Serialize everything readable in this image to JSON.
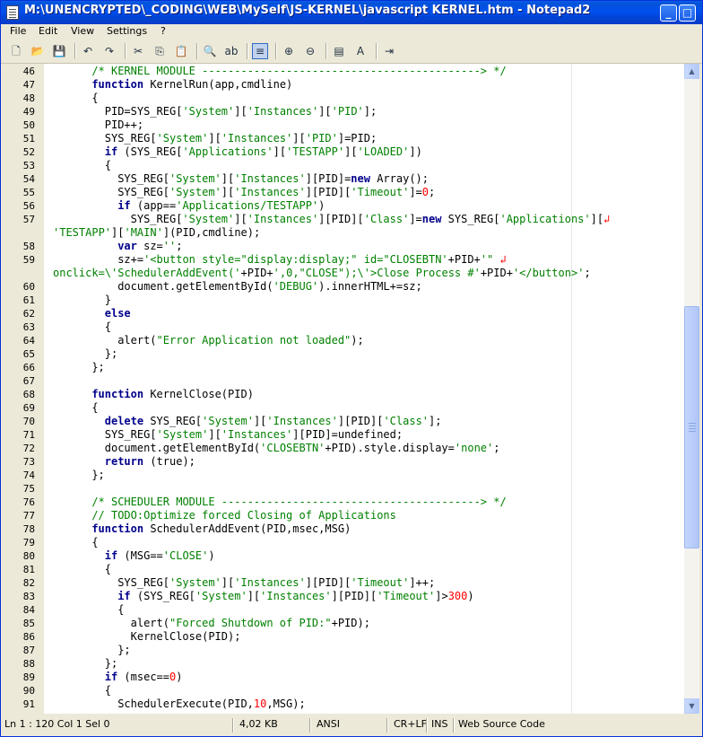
{
  "window": {
    "title": "M:\\UNENCRYPTED\\_CODING\\WEB\\MySelf\\JS-KERNEL\\javascript KERNEL.htm - Notepad2",
    "minimize_glyph": "_",
    "maximize_glyph": "□",
    "close_glyph": "✕"
  },
  "menu": [
    "File",
    "Edit",
    "View",
    "Settings",
    "?"
  ],
  "toolbar_icons": [
    "new-icon",
    "open-icon",
    "save-icon",
    "undo-icon",
    "redo-icon",
    "cut-icon",
    "copy-icon",
    "paste-icon",
    "find-icon",
    "replace-icon",
    "word-wrap-icon",
    "zoom-in-icon",
    "zoom-out-icon",
    "scheme-icon",
    "font-icon",
    "exit-icon"
  ],
  "colors": {
    "keyword": "#00008b",
    "string": "#008000",
    "number": "#ff0000",
    "comment": "#008000",
    "text": "#000000",
    "wrap_marker": "#ff0000"
  },
  "editor": {
    "lines": [
      {
        "n": "46",
        "t": [
          [
            "c",
            "/* KERNEL MODULE -------------------------------------------> */"
          ]
        ]
      },
      {
        "n": "47",
        "t": [
          [
            "k",
            "function"
          ],
          [
            "p",
            " KernelRun(app,cmdline)"
          ]
        ]
      },
      {
        "n": "48",
        "t": [
          [
            "p",
            "{"
          ]
        ]
      },
      {
        "n": "49",
        "t": [
          [
            "p",
            "PID=SYS_REG["
          ],
          [
            "s",
            "'System'"
          ],
          [
            "p",
            "]["
          ],
          [
            "s",
            "'Instances'"
          ],
          [
            "p",
            "]["
          ],
          [
            "s",
            "'PID'"
          ],
          [
            "p",
            "];"
          ]
        ]
      },
      {
        "n": "50",
        "t": [
          [
            "p",
            "PID++;"
          ]
        ]
      },
      {
        "n": "51",
        "t": [
          [
            "p",
            "SYS_REG["
          ],
          [
            "s",
            "'System'"
          ],
          [
            "p",
            "]["
          ],
          [
            "s",
            "'Instances'"
          ],
          [
            "p",
            "]["
          ],
          [
            "s",
            "'PID'"
          ],
          [
            "p",
            "]=PID;"
          ]
        ]
      },
      {
        "n": "52",
        "t": [
          [
            "k",
            "if"
          ],
          [
            "p",
            " (SYS_REG["
          ],
          [
            "s",
            "'Applications'"
          ],
          [
            "p",
            "]["
          ],
          [
            "s",
            "'TESTAPP'"
          ],
          [
            "p",
            "]["
          ],
          [
            "s",
            "'LOADED'"
          ],
          [
            "p",
            "])"
          ]
        ]
      },
      {
        "n": "53",
        "t": [
          [
            "p",
            "{"
          ]
        ]
      },
      {
        "n": "54",
        "t": [
          [
            "p",
            "SYS_REG["
          ],
          [
            "s",
            "'System'"
          ],
          [
            "p",
            "]["
          ],
          [
            "s",
            "'Instances'"
          ],
          [
            "p",
            "][PID]="
          ],
          [
            "k",
            "new"
          ],
          [
            "p",
            " Array();"
          ]
        ]
      },
      {
        "n": "55",
        "t": [
          [
            "p",
            "SYS_REG["
          ],
          [
            "s",
            "'System'"
          ],
          [
            "p",
            "]["
          ],
          [
            "s",
            "'Instances'"
          ],
          [
            "p",
            "][PID]["
          ],
          [
            "s",
            "'Timeout'"
          ],
          [
            "p",
            "]="
          ],
          [
            "n",
            "0"
          ],
          [
            "p",
            ";"
          ]
        ]
      },
      {
        "n": "56",
        "t": [
          [
            "k",
            "if"
          ],
          [
            "p",
            " (app=="
          ],
          [
            "s",
            "'Applications/TESTAPP'"
          ],
          [
            "p",
            ")"
          ]
        ]
      },
      {
        "n": "57",
        "t": [
          [
            "p",
            "SYS_REG["
          ],
          [
            "s",
            "'System'"
          ],
          [
            "p",
            "]["
          ],
          [
            "s",
            "'Instances'"
          ],
          [
            "p",
            "][PID]["
          ],
          [
            "s",
            "'Class'"
          ],
          [
            "p",
            "]="
          ],
          [
            "k",
            "new"
          ],
          [
            "p",
            " SYS_REG["
          ],
          [
            "s",
            "'Applications'"
          ],
          [
            "p",
            "]["
          ],
          [
            "w",
            "↲"
          ]
        ]
      },
      {
        "n": "",
        "t": [
          [
            "s",
            "'TESTAPP'"
          ],
          [
            "p",
            "]["
          ],
          [
            "s",
            "'MAIN'"
          ],
          [
            "p",
            "](PID,cmdline);"
          ]
        ]
      },
      {
        "n": "58",
        "t": [
          [
            "k",
            "var"
          ],
          [
            "p",
            " sz="
          ],
          [
            "s",
            "''"
          ],
          [
            "p",
            ";"
          ]
        ]
      },
      {
        "n": "59",
        "t": [
          [
            "p",
            "sz+="
          ],
          [
            "s",
            "'<button style=\"display:display;\" id=\"CLOSEBTN'"
          ],
          [
            "p",
            "+PID+"
          ],
          [
            "s",
            "'\" "
          ],
          [
            "w",
            "↲"
          ]
        ]
      },
      {
        "n": "",
        "t": [
          [
            "s",
            "onclick=\\'SchedulerAddEvent('"
          ],
          [
            "p",
            "+PID+"
          ],
          [
            "s",
            "',0,\"CLOSE\");\\'>Close Process #'"
          ],
          [
            "p",
            "+PID+"
          ],
          [
            "s",
            "'</button>'"
          ],
          [
            "p",
            ";"
          ]
        ]
      },
      {
        "n": "60",
        "t": [
          [
            "p",
            "document.getElementById("
          ],
          [
            "s",
            "'DEBUG'"
          ],
          [
            "p",
            ").innerHTML+=sz;"
          ]
        ]
      },
      {
        "n": "61",
        "t": [
          [
            "p",
            "}"
          ]
        ]
      },
      {
        "n": "62",
        "t": [
          [
            "k",
            "else"
          ]
        ]
      },
      {
        "n": "63",
        "t": [
          [
            "p",
            "{"
          ]
        ]
      },
      {
        "n": "64",
        "t": [
          [
            "p",
            "alert("
          ],
          [
            "s",
            "\"Error Application not loaded\""
          ],
          [
            "p",
            ");"
          ]
        ]
      },
      {
        "n": "65",
        "t": [
          [
            "p",
            "};"
          ]
        ]
      },
      {
        "n": "66",
        "t": [
          [
            "p",
            "};"
          ]
        ]
      },
      {
        "n": "67",
        "t": []
      },
      {
        "n": "68",
        "t": [
          [
            "k",
            "function"
          ],
          [
            "p",
            " KernelClose(PID)"
          ]
        ]
      },
      {
        "n": "69",
        "t": [
          [
            "p",
            "{"
          ]
        ]
      },
      {
        "n": "70",
        "t": [
          [
            "k",
            "delete"
          ],
          [
            "p",
            " SYS_REG["
          ],
          [
            "s",
            "'System'"
          ],
          [
            "p",
            "]["
          ],
          [
            "s",
            "'Instances'"
          ],
          [
            "p",
            "][PID]["
          ],
          [
            "s",
            "'Class'"
          ],
          [
            "p",
            "];"
          ]
        ]
      },
      {
        "n": "71",
        "t": [
          [
            "p",
            "SYS_REG["
          ],
          [
            "s",
            "'System'"
          ],
          [
            "p",
            "]["
          ],
          [
            "s",
            "'Instances'"
          ],
          [
            "p",
            "][PID]=undefined;"
          ]
        ]
      },
      {
        "n": "72",
        "t": [
          [
            "p",
            "document.getElementById("
          ],
          [
            "s",
            "'CLOSEBTN'"
          ],
          [
            "p",
            "+PID).style.display="
          ],
          [
            "s",
            "'none'"
          ],
          [
            "p",
            ";"
          ]
        ]
      },
      {
        "n": "73",
        "t": [
          [
            "k",
            "return"
          ],
          [
            "p",
            " (true);"
          ]
        ]
      },
      {
        "n": "74",
        "t": [
          [
            "p",
            "};"
          ]
        ]
      },
      {
        "n": "75",
        "t": []
      },
      {
        "n": "76",
        "t": [
          [
            "c",
            "/* SCHEDULER MODULE ----------------------------------------> */"
          ]
        ]
      },
      {
        "n": "77",
        "t": [
          [
            "c",
            "// TODO:Optimize forced Closing of Applications"
          ]
        ]
      },
      {
        "n": "78",
        "t": [
          [
            "k",
            "function"
          ],
          [
            "p",
            " SchedulerAddEvent(PID,msec,MSG)"
          ]
        ]
      },
      {
        "n": "79",
        "t": [
          [
            "p",
            "{"
          ]
        ]
      },
      {
        "n": "80",
        "t": [
          [
            "k",
            "if"
          ],
          [
            "p",
            " (MSG=="
          ],
          [
            "s",
            "'CLOSE'"
          ],
          [
            "p",
            ")"
          ]
        ]
      },
      {
        "n": "81",
        "t": [
          [
            "p",
            "{"
          ]
        ]
      },
      {
        "n": "82",
        "t": [
          [
            "p",
            "SYS_REG["
          ],
          [
            "s",
            "'System'"
          ],
          [
            "p",
            "]["
          ],
          [
            "s",
            "'Instances'"
          ],
          [
            "p",
            "][PID]["
          ],
          [
            "s",
            "'Timeout'"
          ],
          [
            "p",
            "]++;"
          ]
        ]
      },
      {
        "n": "83",
        "t": [
          [
            "k",
            "if"
          ],
          [
            "p",
            " (SYS_REG["
          ],
          [
            "s",
            "'System'"
          ],
          [
            "p",
            "]["
          ],
          [
            "s",
            "'Instances'"
          ],
          [
            "p",
            "][PID]["
          ],
          [
            "s",
            "'Timeout'"
          ],
          [
            "p",
            "]>"
          ],
          [
            "n",
            "300"
          ],
          [
            "p",
            ")"
          ]
        ]
      },
      {
        "n": "84",
        "t": [
          [
            "p",
            "{"
          ]
        ]
      },
      {
        "n": "85",
        "t": [
          [
            "p",
            "alert("
          ],
          [
            "s",
            "\"Forced Shutdown of PID:\""
          ],
          [
            "p",
            "+PID);"
          ]
        ]
      },
      {
        "n": "86",
        "t": [
          [
            "p",
            "KernelClose(PID);"
          ]
        ]
      },
      {
        "n": "87",
        "t": [
          [
            "p",
            "};"
          ]
        ]
      },
      {
        "n": "88",
        "t": [
          [
            "p",
            "};"
          ]
        ]
      },
      {
        "n": "89",
        "t": [
          [
            "k",
            "if"
          ],
          [
            "p",
            " (msec=="
          ],
          [
            "n",
            "0"
          ],
          [
            "p",
            ")"
          ]
        ]
      },
      {
        "n": "90",
        "t": [
          [
            "p",
            "{"
          ]
        ]
      },
      {
        "n": "91",
        "t": [
          [
            "p",
            "SchedulerExecute(PID,"
          ],
          [
            "n",
            "10"
          ],
          [
            "p",
            ",MSG);"
          ]
        ]
      }
    ]
  },
  "status": {
    "position": "Ln 1 : 120   Col 1   Sel 0",
    "size": "4,02 KB",
    "encoding": "ANSI",
    "line_endings": "CR+LF",
    "mode": "INS",
    "scheme": "Web Source Code"
  }
}
